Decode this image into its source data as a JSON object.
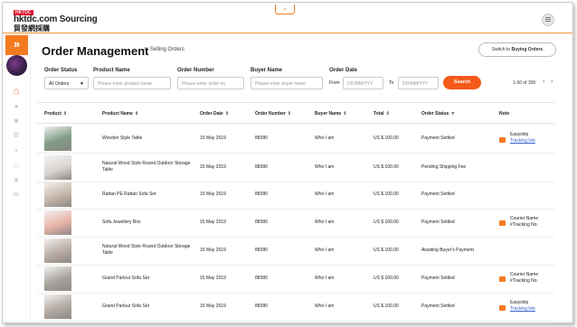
{
  "header": {
    "logo_tag": "HKTDC",
    "logo_line1": "hktdc.com Sourcing",
    "logo_line2": "貿發網採購",
    "dropdown_glyph": "⌄",
    "expand_glyph": "»"
  },
  "page": {
    "title": "Order Management",
    "breadcrumb_sep": ">",
    "breadcrumb": "Selling Orders",
    "switch_prefix": "Switch to ",
    "switch_bold": "Buying Orders"
  },
  "filters": {
    "order_status_label": "Order Status",
    "order_status_value": "All Orders",
    "product_name_label": "Product Name",
    "product_name_placeholder": "Please enter product name",
    "order_number_label": "Order Number",
    "order_number_placeholder": "Please enter order no.",
    "buyer_name_label": "Buyer Name",
    "buyer_name_placeholder": "Please enter buyer name",
    "order_date_label": "Order Date",
    "from_label": "From",
    "to_label": "To",
    "date_placeholder": "DD/MM/YYY",
    "search_label": "Search",
    "pagination": "1-50 of 300"
  },
  "columns": {
    "product": "Product",
    "product_name": "Product Name",
    "order_date": "Order Date",
    "order_number": "Order Number",
    "buyer_name": "Buyer Name",
    "total": "Total",
    "order_status": "Order Status",
    "note": "Note"
  },
  "rows": [
    {
      "name": "Wooden Style Table",
      "date": "15 May 2019",
      "number": "88380",
      "buyer": "Who I am",
      "total": "US $ 100.00",
      "status": "Payment Settled",
      "note1": "Easyship",
      "note2": "Tracking link",
      "note_link": true
    },
    {
      "name": "Natural Wood Style Round Outdoor Storage Table",
      "date": "15 May 2019",
      "number": "88380",
      "buyer": "Who I am",
      "total": "US $ 100.00",
      "status": "Pending Shipping Fee",
      "note1": "",
      "note2": "",
      "note_link": false
    },
    {
      "name": "Rattan PE Rattan Sofa Set",
      "date": "15 May 2019",
      "number": "88380",
      "buyer": "Who I am",
      "total": "US $ 100.00",
      "status": "Payment Settled",
      "note1": "",
      "note2": "",
      "note_link": false
    },
    {
      "name": "Sofa Jewellery Box",
      "date": "15 May 2019",
      "number": "88380",
      "buyer": "Who I am",
      "total": "US $ 100.00",
      "status": "Payment Settled",
      "note1": "Courier Name",
      "note2": "#Tracking No.",
      "note_link": false
    },
    {
      "name": "Natural Wood Style Round Outdoor Storage Table",
      "date": "15 May 2019",
      "number": "88380",
      "buyer": "Who I am",
      "total": "US $ 100.00",
      "status": "Awaiting Buyer's Payment",
      "note1": "",
      "note2": "",
      "note_link": false
    },
    {
      "name": "Grand Parlour Sofa Set",
      "date": "15 May 2019",
      "number": "88380",
      "buyer": "Who I am",
      "total": "US $ 100.00",
      "status": "Payment Settled",
      "note1": "Courier Name",
      "note2": "#Tracking No.",
      "note_link": false
    },
    {
      "name": "Grand Parlour Sofa Set",
      "date": "15 May 2019",
      "number": "88380",
      "buyer": "Who I am",
      "total": "US $ 100.00",
      "status": "Payment Settled",
      "note1": "Easyship",
      "note2": "Tracking link",
      "note_link": true
    }
  ],
  "thumb_colors": [
    "#7f9c86",
    "#d9d6d2",
    "#c5b7a9",
    "#e8b3a8",
    "#b9aca3",
    "#a8a39e",
    "#b2aaa3"
  ],
  "colors": {
    "accent": "#f47a20",
    "search": "#f45a1a",
    "link": "#3366cc"
  }
}
